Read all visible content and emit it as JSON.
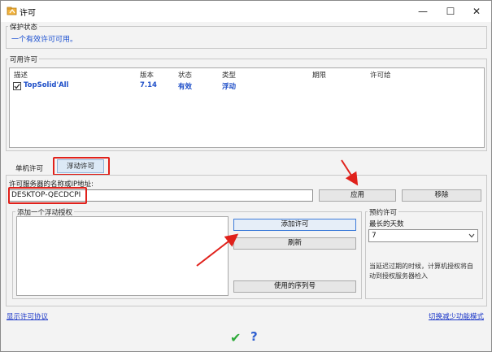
{
  "window": {
    "title": "许可",
    "minimize": "—",
    "maximize": "☐",
    "close": "✕"
  },
  "protection": {
    "label": "保护状态",
    "status": "一个有效许可可用。"
  },
  "licenses": {
    "label": "可用许可",
    "columns": [
      "描述",
      "版本",
      "状态",
      "类型",
      "期限",
      "许可给"
    ],
    "rows": [
      {
        "desc": "TopSolid'All",
        "version": "7.14",
        "status": "有效",
        "type": "浮动",
        "term": "",
        "licensee": ""
      }
    ]
  },
  "tabs": {
    "single": "单机许可",
    "floating": "浮动许可"
  },
  "server": {
    "label": "许可服务器的名称或IP地址:",
    "value": "DESKTOP-QECDCPI",
    "apply": "应用",
    "remove": "移除"
  },
  "floating_auth": {
    "label": "添加一个浮动授权",
    "add": "添加许可",
    "refresh": "刷新",
    "used_serials": "使用的序列号"
  },
  "reserve": {
    "label": "预约许可",
    "max_days_label": "最长的天数",
    "max_days_value": "7",
    "note": "当延迟过期的时候，计算机授权将自动到授权服务器检入"
  },
  "footer": {
    "show_agreement": "显示许可协议",
    "reduce_mode": "切换减少功能模式",
    "ok_icon": "✔",
    "help_icon": "?"
  },
  "colors": {
    "highlight_red": "#e0211b",
    "accent_blue": "#1a4fd1",
    "ok_green": "#2eaa3a"
  }
}
